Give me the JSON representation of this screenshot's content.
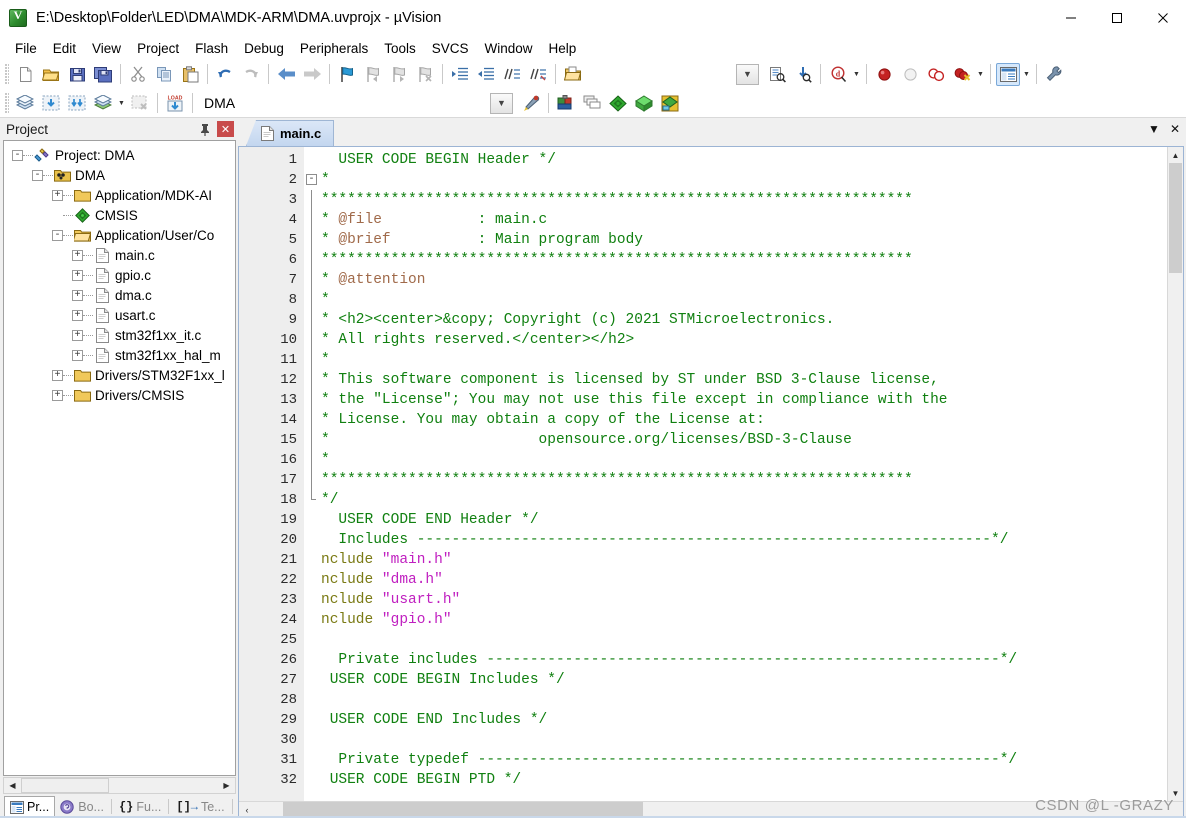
{
  "window": {
    "title": "E:\\Desktop\\Folder\\LED\\DMA\\MDK-ARM\\DMA.uvprojx - µVision",
    "icon": "uvision-app-icon",
    "minimize": "—",
    "maximize": "☐",
    "close": "✕"
  },
  "menubar": {
    "items": [
      {
        "label": "File"
      },
      {
        "label": "Edit"
      },
      {
        "label": "View"
      },
      {
        "label": "Project"
      },
      {
        "label": "Flash"
      },
      {
        "label": "Debug"
      },
      {
        "label": "Peripherals"
      },
      {
        "label": "Tools"
      },
      {
        "label": "SVCS"
      },
      {
        "label": "Window"
      },
      {
        "label": "Help"
      }
    ]
  },
  "toolbar_main": {
    "buttons": [
      {
        "name": "new-file-icon",
        "title": "New"
      },
      {
        "name": "open-file-icon",
        "title": "Open"
      },
      {
        "name": "save-icon",
        "title": "Save"
      },
      {
        "name": "save-all-icon",
        "title": "Save All"
      },
      {
        "name": "cut-icon",
        "title": "Cut"
      },
      {
        "name": "copy-icon",
        "title": "Copy"
      },
      {
        "name": "paste-icon",
        "title": "Paste"
      },
      {
        "name": "undo-icon",
        "title": "Undo"
      },
      {
        "name": "redo-icon",
        "title": "Redo"
      },
      {
        "name": "navigate-back-icon",
        "title": "Back"
      },
      {
        "name": "navigate-forward-icon",
        "title": "Forward"
      },
      {
        "name": "bookmark-toggle-icon",
        "title": "Insert/Remove Bookmark"
      },
      {
        "name": "bookmark-prev-icon",
        "title": "Previous Bookmark"
      },
      {
        "name": "bookmark-next-icon",
        "title": "Next Bookmark"
      },
      {
        "name": "bookmark-clear-icon",
        "title": "Clear All Bookmarks"
      },
      {
        "name": "indent-right-icon",
        "title": "Indent"
      },
      {
        "name": "indent-left-icon",
        "title": "Outdent"
      },
      {
        "name": "comment-icon",
        "title": "Comment"
      },
      {
        "name": "uncomment-icon",
        "title": "Uncomment"
      },
      {
        "name": "open-folder-doc-icon",
        "title": "Open Document"
      },
      {
        "name": "find-in-files-icon",
        "title": "Find in Files"
      },
      {
        "name": "find-icon",
        "title": "Find"
      },
      {
        "name": "debug-start-icon",
        "title": "Start/Stop Debug Session"
      },
      {
        "name": "breakpoint-insert-icon",
        "title": "Insert/Remove Breakpoint"
      },
      {
        "name": "breakpoint-disable-icon",
        "title": "Disable Breakpoint"
      },
      {
        "name": "breakpoint-disable-all-icon",
        "title": "Disable All Breakpoints"
      },
      {
        "name": "breakpoint-kill-all-icon",
        "title": "Kill All Breakpoints"
      },
      {
        "name": "window-manage-icon",
        "title": "Manage Windows"
      },
      {
        "name": "configure-icon",
        "title": "Configuration Wizard"
      }
    ],
    "combo_value": ""
  },
  "toolbar_build": {
    "buttons": [
      {
        "name": "translate-icon",
        "title": "Translate"
      },
      {
        "name": "build-icon",
        "title": "Build"
      },
      {
        "name": "rebuild-icon",
        "title": "Rebuild"
      },
      {
        "name": "batch-build-icon",
        "title": "Batch Build"
      },
      {
        "name": "stop-build-icon",
        "title": "Stop Build"
      },
      {
        "name": "download-icon",
        "title": "Download (LOAD)"
      },
      {
        "name": "target-options-icon",
        "title": "Options for Target"
      },
      {
        "name": "manage-project-items-icon",
        "title": "Manage Project Items"
      },
      {
        "name": "run-time-env-icon",
        "title": "Manage Run-Time Environment"
      },
      {
        "name": "pack-installer-icon",
        "title": "Pack Installer"
      },
      {
        "name": "select-software-packs-icon",
        "title": "Select Software Packs"
      }
    ],
    "target_select": {
      "value": "DMA",
      "placeholder": "Select Target"
    }
  },
  "project_pane": {
    "title": "Project",
    "pin_icon": "pin-icon",
    "close_icon": "close-icon",
    "tree": [
      {
        "depth": 0,
        "toggle": "-",
        "icon": "project-icon",
        "label": "Project: DMA"
      },
      {
        "depth": 1,
        "toggle": "-",
        "icon": "target-icon",
        "label": "DMA"
      },
      {
        "depth": 2,
        "toggle": "+",
        "icon": "folder-icon",
        "label": "Application/MDK-AI"
      },
      {
        "depth": 2,
        "toggle": "",
        "icon": "cmsis-icon",
        "label": "CMSIS"
      },
      {
        "depth": 2,
        "toggle": "-",
        "icon": "folder-open-icon",
        "label": "Application/User/Co"
      },
      {
        "depth": 3,
        "toggle": "+",
        "icon": "c-file-icon",
        "label": "main.c"
      },
      {
        "depth": 3,
        "toggle": "+",
        "icon": "c-file-icon",
        "label": "gpio.c"
      },
      {
        "depth": 3,
        "toggle": "+",
        "icon": "c-file-icon",
        "label": "dma.c"
      },
      {
        "depth": 3,
        "toggle": "+",
        "icon": "c-file-icon",
        "label": "usart.c"
      },
      {
        "depth": 3,
        "toggle": "+",
        "icon": "c-file-icon",
        "label": "stm32f1xx_it.c"
      },
      {
        "depth": 3,
        "toggle": "+",
        "icon": "c-file-icon",
        "label": "stm32f1xx_hal_m"
      },
      {
        "depth": 2,
        "toggle": "+",
        "icon": "folder-icon",
        "label": "Drivers/STM32F1xx_l"
      },
      {
        "depth": 2,
        "toggle": "+",
        "icon": "folder-icon",
        "label": "Drivers/CMSIS"
      }
    ],
    "bottom_tabs": [
      {
        "label": "Pr...",
        "icon": "project-tab-icon",
        "selected": true
      },
      {
        "label": "Bo...",
        "icon": "books-tab-icon",
        "selected": false
      },
      {
        "label": "Fu...",
        "icon": "functions-tab-icon",
        "selected": false
      },
      {
        "label": "Te...",
        "icon": "templates-tab-icon",
        "selected": false
      }
    ],
    "hscroll": {
      "left_arrow": "◀",
      "right_arrow": "▶"
    }
  },
  "editor": {
    "tabs": [
      {
        "label": "main.c",
        "icon": "c-file-icon",
        "active": true
      }
    ],
    "tab_controls": {
      "dropdown": "▼",
      "close": "✕"
    },
    "scroll": {
      "up_arrow": "▲",
      "down_arrow": "▼",
      "left_arrow": "‹",
      "right_arrow": "›"
    },
    "lines": [
      {
        "n": 1,
        "fold": "",
        "segs": [
          {
            "t": "  USER CODE BEGIN Header */",
            "c": "c-cmt"
          }
        ]
      },
      {
        "n": 2,
        "fold": "start",
        "segs": [
          {
            "t": "*",
            "c": "c-cmt"
          }
        ]
      },
      {
        "n": 3,
        "fold": "bar",
        "segs": [
          {
            "t": "********************************************************************",
            "c": "c-cmt"
          }
        ]
      },
      {
        "n": 4,
        "fold": "bar",
        "segs": [
          {
            "t": "* ",
            "c": "c-cmt"
          },
          {
            "t": "@file",
            "c": "c-tag"
          },
          {
            "t": "           : main.c",
            "c": "c-cmt"
          }
        ]
      },
      {
        "n": 5,
        "fold": "bar",
        "segs": [
          {
            "t": "* ",
            "c": "c-cmt"
          },
          {
            "t": "@brief",
            "c": "c-tag"
          },
          {
            "t": "          : Main program body",
            "c": "c-cmt"
          }
        ]
      },
      {
        "n": 6,
        "fold": "bar",
        "segs": [
          {
            "t": "********************************************************************",
            "c": "c-cmt"
          }
        ]
      },
      {
        "n": 7,
        "fold": "bar",
        "segs": [
          {
            "t": "* ",
            "c": "c-cmt"
          },
          {
            "t": "@attention",
            "c": "c-tag"
          }
        ]
      },
      {
        "n": 8,
        "fold": "bar",
        "segs": [
          {
            "t": "*",
            "c": "c-cmt"
          }
        ]
      },
      {
        "n": 9,
        "fold": "bar",
        "segs": [
          {
            "t": "* <h2><center>&copy; Copyright (c) 2021 STMicroelectronics.",
            "c": "c-cmt"
          }
        ]
      },
      {
        "n": 10,
        "fold": "bar",
        "segs": [
          {
            "t": "* All rights reserved.</center></h2>",
            "c": "c-cmt"
          }
        ]
      },
      {
        "n": 11,
        "fold": "bar",
        "segs": [
          {
            "t": "*",
            "c": "c-cmt"
          }
        ]
      },
      {
        "n": 12,
        "fold": "bar",
        "segs": [
          {
            "t": "* This software component is licensed by ST under BSD 3-Clause license,",
            "c": "c-cmt"
          }
        ]
      },
      {
        "n": 13,
        "fold": "bar",
        "segs": [
          {
            "t": "* the \"License\"; You may not use this file except in compliance with the",
            "c": "c-cmt"
          }
        ]
      },
      {
        "n": 14,
        "fold": "bar",
        "segs": [
          {
            "t": "* License. You may obtain a copy of the License at:",
            "c": "c-cmt"
          }
        ]
      },
      {
        "n": 15,
        "fold": "bar",
        "segs": [
          {
            "t": "*                        opensource.org/licenses/BSD-3-Clause",
            "c": "c-cmt"
          }
        ]
      },
      {
        "n": 16,
        "fold": "bar",
        "segs": [
          {
            "t": "*",
            "c": "c-cmt"
          }
        ]
      },
      {
        "n": 17,
        "fold": "bar",
        "segs": [
          {
            "t": "********************************************************************",
            "c": "c-cmt"
          }
        ]
      },
      {
        "n": 18,
        "fold": "end",
        "segs": [
          {
            "t": "*/",
            "c": "c-cmt"
          }
        ]
      },
      {
        "n": 19,
        "fold": "",
        "segs": [
          {
            "t": "  USER CODE END Header */",
            "c": "c-cmt"
          }
        ]
      },
      {
        "n": 20,
        "fold": "",
        "segs": [
          {
            "t": "  Includes ------------------------------------------------------------------*/",
            "c": "c-cmt"
          }
        ]
      },
      {
        "n": 21,
        "fold": "",
        "segs": [
          {
            "t": "nclude ",
            "c": "c-kw"
          },
          {
            "t": "\"main.h\"",
            "c": "c-str"
          }
        ]
      },
      {
        "n": 22,
        "fold": "",
        "segs": [
          {
            "t": "nclude ",
            "c": "c-kw"
          },
          {
            "t": "\"dma.h\"",
            "c": "c-str"
          }
        ]
      },
      {
        "n": 23,
        "fold": "",
        "segs": [
          {
            "t": "nclude ",
            "c": "c-kw"
          },
          {
            "t": "\"usart.h\"",
            "c": "c-str"
          }
        ]
      },
      {
        "n": 24,
        "fold": "",
        "segs": [
          {
            "t": "nclude ",
            "c": "c-kw"
          },
          {
            "t": "\"gpio.h\"",
            "c": "c-str"
          }
        ]
      },
      {
        "n": 25,
        "fold": "",
        "segs": []
      },
      {
        "n": 26,
        "fold": "",
        "segs": [
          {
            "t": "  Private includes -----------------------------------------------------------*/",
            "c": "c-cmt"
          }
        ]
      },
      {
        "n": 27,
        "fold": "",
        "segs": [
          {
            "t": " USER CODE BEGIN Includes */",
            "c": "c-cmt"
          }
        ]
      },
      {
        "n": 28,
        "fold": "",
        "segs": []
      },
      {
        "n": 29,
        "fold": "",
        "segs": [
          {
            "t": " USER CODE END Includes */",
            "c": "c-cmt"
          }
        ]
      },
      {
        "n": 30,
        "fold": "",
        "segs": []
      },
      {
        "n": 31,
        "fold": "",
        "segs": [
          {
            "t": "  Private typedef ------------------------------------------------------------*/",
            "c": "c-cmt"
          }
        ]
      },
      {
        "n": 32,
        "fold": "",
        "segs": [
          {
            "t": " USER CODE BEGIN PTD */",
            "c": "c-cmt"
          }
        ]
      }
    ]
  },
  "watermark": {
    "text": "CSDN @L -GRAZY"
  },
  "colors": {
    "comment_green": "#108010",
    "doc_tag_brown": "#a06a4a",
    "preproc_olive": "#7a7a14",
    "string_magenta": "#c020c0",
    "tab_blue": "#c3d6ef",
    "pane_close_red": "#c84b4b"
  }
}
